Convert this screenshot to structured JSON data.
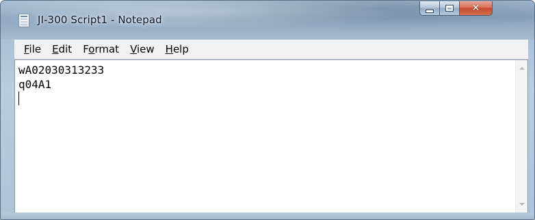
{
  "window": {
    "title": "JI-300 Script1 - Notepad",
    "close_glyph": "✕"
  },
  "menu": {
    "items": [
      {
        "mnemonic": "F",
        "rest": "ile"
      },
      {
        "mnemonic": "E",
        "rest": "dit"
      },
      {
        "pre": "F",
        "mnemonic": "o",
        "rest": "rmat"
      },
      {
        "mnemonic": "V",
        "rest": "iew"
      },
      {
        "mnemonic": "H",
        "rest": "elp"
      }
    ]
  },
  "document": {
    "lines": [
      "wA02030313233",
      "q04A1",
      ""
    ]
  },
  "icons": {
    "app": "notepad-icon",
    "minimize": "minimize-icon",
    "maximize": "maximize-icon",
    "close": "close-icon",
    "scroll_up": "scroll-up-arrow-icon",
    "scroll_down": "scroll-down-arrow-icon"
  },
  "colors": {
    "title_text": "#0c1a2b",
    "close_button": "#c34a2f",
    "menu_background": "#f1f1f1",
    "editor_background": "#ffffff"
  }
}
